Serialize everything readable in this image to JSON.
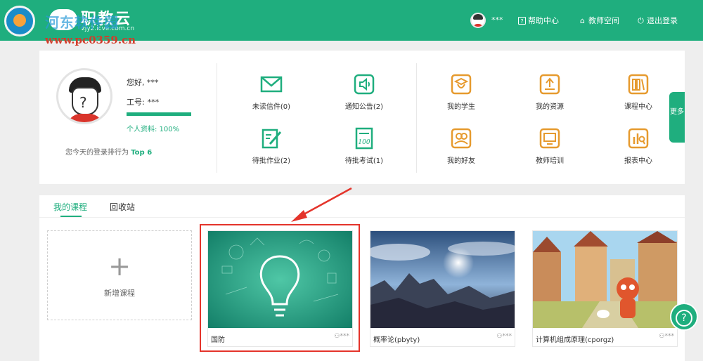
{
  "header": {
    "logo_title": "职教云",
    "logo_sub": "zjy2.icve.com.cn",
    "watermark_text": "河东软件园",
    "watermark_url": "www.pc0359.cn",
    "user_name": "***",
    "help_label": "帮助中心",
    "teacher_space_label": "教师空间",
    "logout_label": "退出登录"
  },
  "profile": {
    "greeting": "您好, ***",
    "job_label": "工号:",
    "job_value": "***",
    "completion_label": "个人资料:  100%",
    "completion_fraction": 1.0,
    "rank_prefix": "您今天的登录排行为",
    "rank_value": "Top 6"
  },
  "functions": {
    "unread_mail": "未读信件(0)",
    "notice": "通知公告(2)",
    "pending_homework": "待批作业(2)",
    "pending_exam": "待批考试(1)",
    "my_students": "我的学生",
    "my_resources": "我的资源",
    "course_center": "课程中心",
    "my_friends": "我的好友",
    "teacher_training": "教师培训",
    "report_center": "报表中心"
  },
  "more_tab": "更多",
  "courses": {
    "tabs": [
      "我的课程",
      "回收站"
    ],
    "add_label": "新增课程",
    "items": [
      {
        "name": "国防",
        "owner": "***"
      },
      {
        "name": "概率论(pbyty)",
        "owner": "***"
      },
      {
        "name": "计算机组成原理(cporgz)",
        "owner": "***"
      }
    ]
  },
  "colors": {
    "accent": "#1fae7e",
    "highlight": "#e4342b"
  }
}
